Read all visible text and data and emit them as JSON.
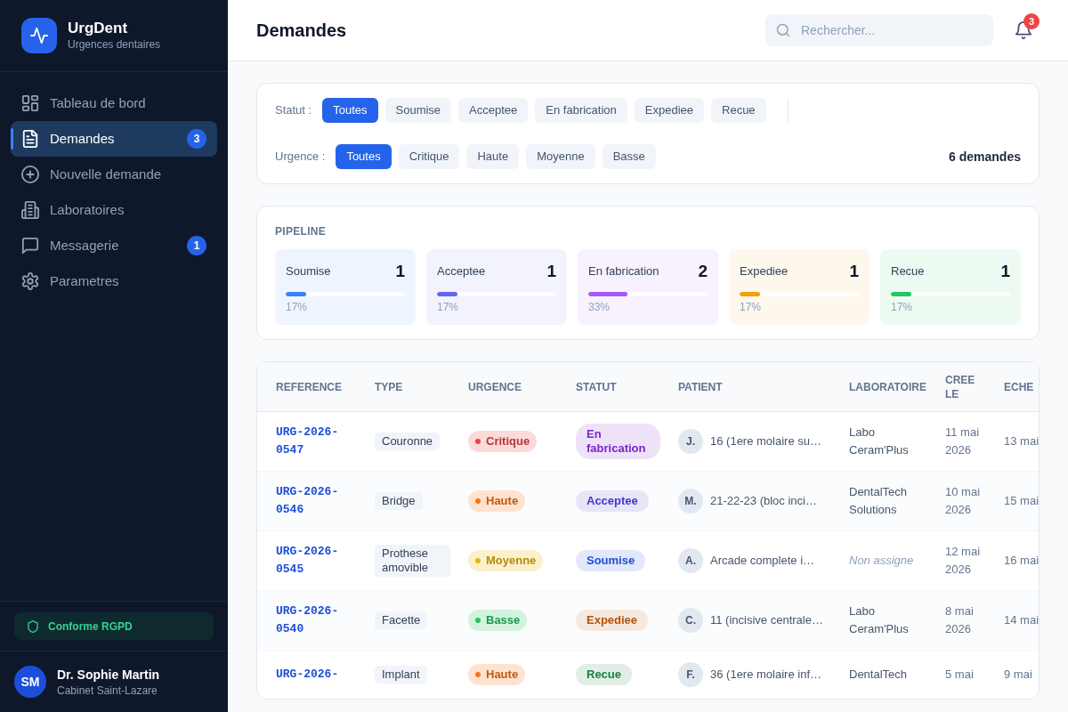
{
  "sidebar": {
    "brand": {
      "name": "UrgDent",
      "tagline": "Urgences dentaires"
    },
    "nav": [
      {
        "label": "Tableau de bord",
        "selected": false
      },
      {
        "label": "Demandes",
        "selected": true,
        "badge": "3"
      },
      {
        "label": "Nouvelle demande",
        "selected": false
      },
      {
        "label": "Laboratoires",
        "selected": false
      },
      {
        "label": "Messagerie",
        "selected": false,
        "badge": "1"
      },
      {
        "label": "Parametres",
        "selected": false
      }
    ],
    "compliance": "Conforme RGPD",
    "user": {
      "initials": "SM",
      "name": "Dr. Sophie Martin",
      "organization": "Cabinet Saint-Lazare"
    }
  },
  "header": {
    "title": "Demandes",
    "search": {
      "placeholder": "Rechercher..."
    },
    "notifications": {
      "count": "3"
    }
  },
  "filters": {
    "status": {
      "label": "Statut :",
      "options": [
        {
          "label": "Toutes",
          "selected": true
        },
        {
          "label": "Soumise",
          "selected": false
        },
        {
          "label": "Acceptee",
          "selected": false
        },
        {
          "label": "En fabrication",
          "selected": false
        },
        {
          "label": "Expediee",
          "selected": false
        },
        {
          "label": "Recue",
          "selected": false
        }
      ]
    },
    "urgency": {
      "label": "Urgence :",
      "options": [
        {
          "label": "Toutes",
          "selected": true
        },
        {
          "label": "Critique",
          "selected": false
        },
        {
          "label": "Haute",
          "selected": false
        },
        {
          "label": "Moyenne",
          "selected": false
        },
        {
          "label": "Basse",
          "selected": false
        }
      ]
    },
    "result_count": "6 demandes"
  },
  "pipeline": {
    "title": "PIPELINE",
    "stages": [
      {
        "label": "Soumise",
        "count": "1",
        "level": 0.17,
        "reading": "17%",
        "color": "#3b82f6"
      },
      {
        "label": "Acceptee",
        "count": "1",
        "level": 0.17,
        "reading": "17%",
        "color": "#6366f1"
      },
      {
        "label": "En fabrication",
        "count": "2",
        "level": 0.33,
        "reading": "33%",
        "color": "#a855f7"
      },
      {
        "label": "Expediee",
        "count": "1",
        "level": 0.17,
        "reading": "17%",
        "color": "#f59e0b"
      },
      {
        "label": "Recue",
        "count": "1",
        "level": 0.17,
        "reading": "17%",
        "color": "#22c55e"
      }
    ]
  },
  "table": {
    "columns": [
      "REFERENCE",
      "TYPE",
      "URGENCE",
      "STATUT",
      "PATIENT",
      "LABORATOIRE",
      "CREE LE",
      "ECHE"
    ],
    "rows": [
      {
        "reference": "URG-2026-0547",
        "type": "Couronne",
        "urgency": {
          "label": "Critique",
          "color": "#ef4444"
        },
        "status": {
          "label": "En fabrication",
          "color": "#7e22ce"
        },
        "patient": {
          "initial": "J.",
          "description": "16 (1ere molaire su…"
        },
        "laboratory": {
          "name": "Labo Ceram'Plus",
          "assigned": true
        },
        "created": "11 mai 2026",
        "due": "13 mai"
      },
      {
        "reference": "URG-2026-0546",
        "type": "Bridge",
        "urgency": {
          "label": "Haute",
          "color": "#f97316"
        },
        "status": {
          "label": "Acceptee",
          "color": "#4338ca"
        },
        "patient": {
          "initial": "M.",
          "description": "21-22-23 (bloc inci…"
        },
        "laboratory": {
          "name": "DentalTech Solutions",
          "assigned": true
        },
        "created": "10 mai 2026",
        "due": "15 mai"
      },
      {
        "reference": "URG-2026-0545",
        "type": "Prothese amovible",
        "urgency": {
          "label": "Moyenne",
          "color": "#eab308"
        },
        "status": {
          "label": "Soumise",
          "color": "#1d4ed8"
        },
        "patient": {
          "initial": "A.",
          "description": "Arcade complete i…"
        },
        "laboratory": {
          "name": "Non assigne",
          "assigned": false
        },
        "created": "12 mai 2026",
        "due": "16 mai"
      },
      {
        "reference": "URG-2026-0540",
        "type": "Facette",
        "urgency": {
          "label": "Basse",
          "color": "#22c55e"
        },
        "status": {
          "label": "Expediee",
          "color": "#b45309"
        },
        "patient": {
          "initial": "C.",
          "description": "11 (incisive centrale…"
        },
        "laboratory": {
          "name": "Labo Ceram'Plus",
          "assigned": true
        },
        "created": "8 mai 2026",
        "due": "14 mai"
      },
      {
        "reference": "URG-2026-",
        "type": "Implant",
        "urgency": {
          "label": "Haute",
          "color": "#f97316"
        },
        "status": {
          "label": "Recue",
          "color": "#15803d"
        },
        "patient": {
          "initial": "F.",
          "description": "36 (1ere molaire inf…"
        },
        "laboratory": {
          "name": "DentalTech",
          "assigned": true
        },
        "created": "5 mai",
        "due": "9 mai"
      }
    ]
  }
}
